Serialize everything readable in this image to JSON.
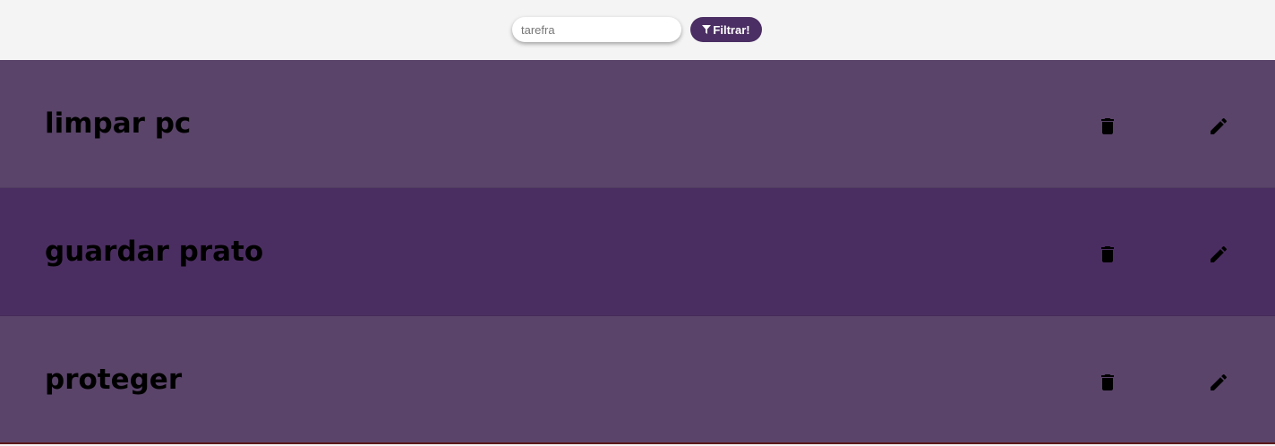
{
  "search": {
    "placeholder": "tarefra"
  },
  "filter": {
    "label": "Filtrar!",
    "icon": "filter-icon"
  },
  "tasks": [
    {
      "title": "limpar pc",
      "delete_icon": "trash-icon",
      "edit_icon": "pencil-icon"
    },
    {
      "title": "guardar prato",
      "delete_icon": "trash-icon",
      "edit_icon": "pencil-icon"
    },
    {
      "title": "proteger",
      "delete_icon": "trash-icon",
      "edit_icon": "pencil-icon"
    }
  ],
  "colors": {
    "accent": "#4b2e63",
    "row_light": "#5a4469",
    "row_dark": "#4b2e61",
    "topbar": "#f4f4f4"
  }
}
